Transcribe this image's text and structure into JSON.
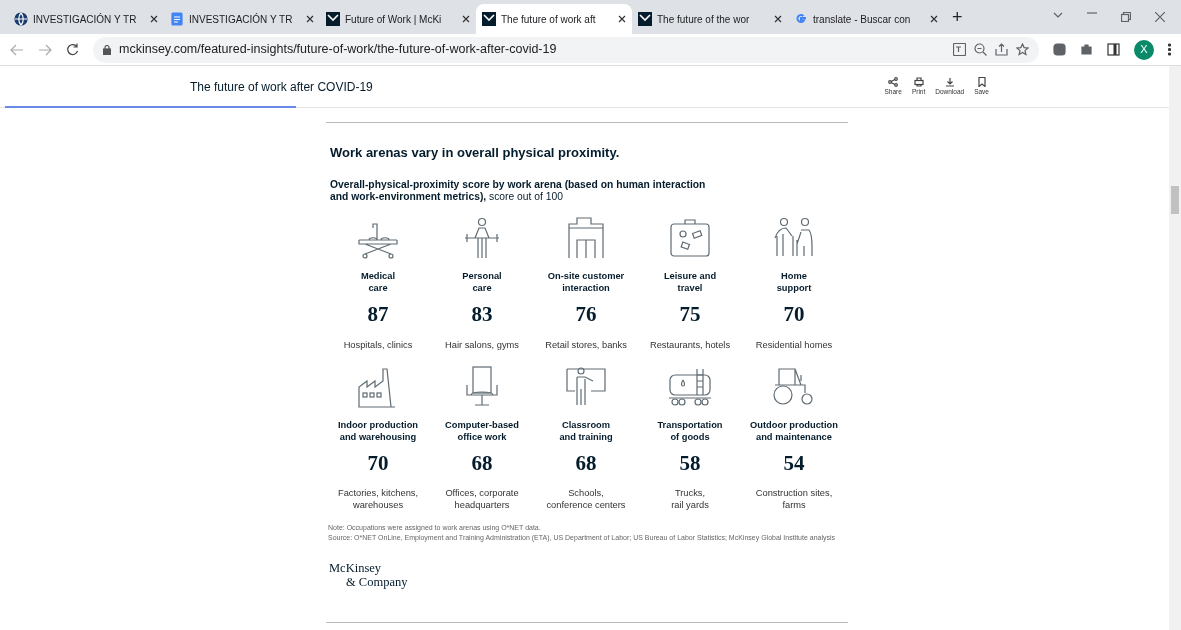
{
  "browser": {
    "tabs": [
      {
        "title": "INVESTIGACIÓN Y TR",
        "kind": "globe",
        "selected": false
      },
      {
        "title": "INVESTIGACIÓN Y TR",
        "kind": "docs",
        "selected": false
      },
      {
        "title": "Future of Work | McKi",
        "kind": "mck",
        "selected": false
      },
      {
        "title": "The future of work aft",
        "kind": "mck",
        "selected": true
      },
      {
        "title": "The future of the wor",
        "kind": "mck",
        "selected": false
      },
      {
        "title": "translate - Buscar con",
        "kind": "google",
        "selected": false
      }
    ],
    "new_tab": "+",
    "url": "mckinsey.com/featured-insights/future-of-work/the-future-of-work-after-covid-19",
    "profile": "X"
  },
  "article_bar": {
    "title": "The future of work after COVID-19",
    "read_progress": {
      "level": 0.25
    },
    "actions": [
      "Share",
      "Print",
      "Download",
      "Save"
    ]
  },
  "exhibit": {
    "title": "Work arenas vary in overall physical proximity.",
    "subtitle": "**Overall-physical-proximity score by work arena (based on human interaction and work-environment metrics),** score out of 100",
    "arenas": [
      {
        "name": "Medical\ncare",
        "score": "87",
        "examples": "Hospitals, clinics"
      },
      {
        "name": "Personal\ncare",
        "score": "83",
        "examples": "Hair salons, gyms"
      },
      {
        "name": "On-site customer\ninteraction",
        "score": "76",
        "examples": "Retail stores, banks"
      },
      {
        "name": "Leisure and\ntravel",
        "score": "75",
        "examples": "Restaurants, hotels"
      },
      {
        "name": "Home\nsupport",
        "score": "70",
        "examples": "Residential homes"
      },
      {
        "name": "Indoor production\nand warehousing",
        "score": "70",
        "examples": "Factories, kitchens,\nwarehouses"
      },
      {
        "name": "Computer-based\noffice work",
        "score": "68",
        "examples": "Offices, corporate\nheadquarters"
      },
      {
        "name": "Classroom\nand training",
        "score": "68",
        "examples": "Schools,\nconference centers"
      },
      {
        "name": "Transportation\nof goods",
        "score": "58",
        "examples": "Trucks,\nrail yards"
      },
      {
        "name": "Outdoor production\nand maintenance",
        "score": "54",
        "examples": "Construction sites,\nfarms"
      }
    ],
    "note": "Note: Occupations were assigned to work arenas using O*NET data.",
    "source": "Source: O*NET OnLine, Employment and Training Administration (ETA), US Department of Labor; US Bureau of Labor Statistics; McKinsey Global Institute analysis",
    "logo": [
      "McKinsey",
      "& Company"
    ]
  }
}
